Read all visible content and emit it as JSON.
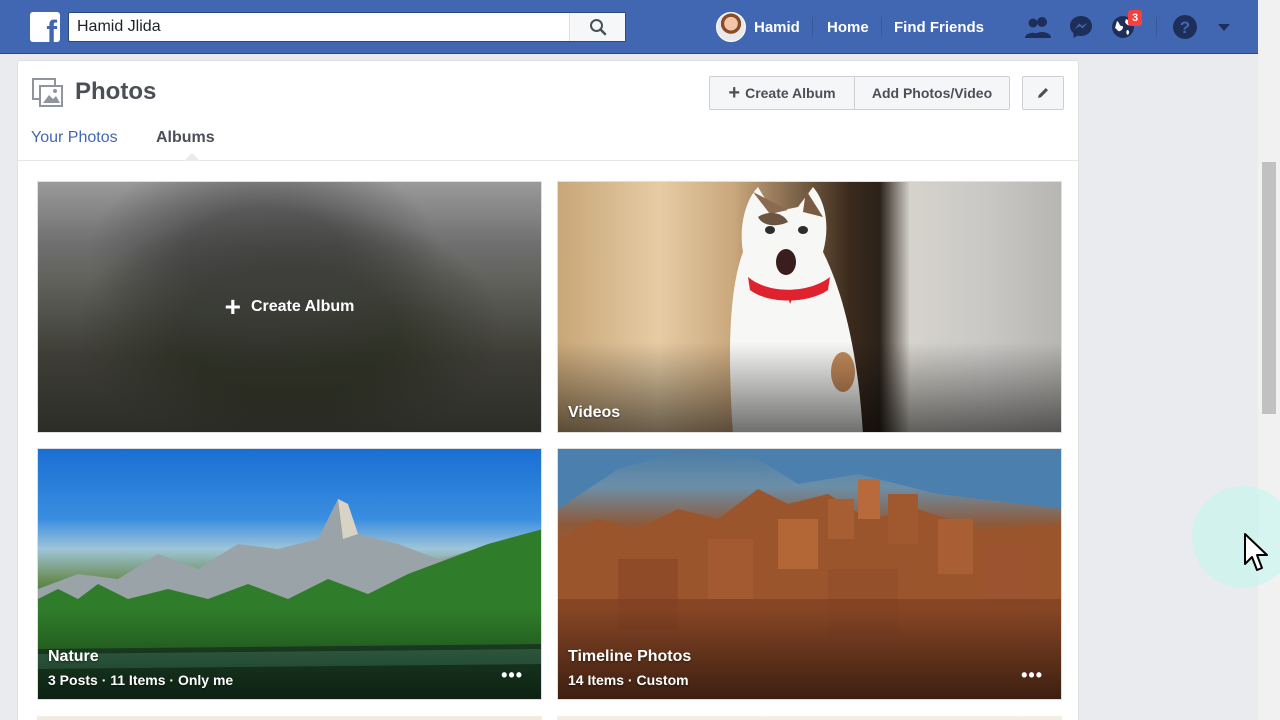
{
  "topbar": {
    "search_value": "Hamid Jlida",
    "user_name": "Hamid",
    "home_label": "Home",
    "find_friends_label": "Find Friends",
    "notification_count": "3"
  },
  "photos": {
    "title": "Photos",
    "create_album_button": "Create Album",
    "add_media_button": "Add Photos/Video",
    "tabs": [
      {
        "label": "Your Photos"
      },
      {
        "label": "Albums"
      }
    ]
  },
  "albums": [
    {
      "title": "Create Album"
    },
    {
      "title": "Videos"
    },
    {
      "title": "Nature",
      "meta": "3 Posts · 11 Items · Only me"
    },
    {
      "title": "Timeline Photos",
      "meta": "14 Items · Custom"
    }
  ],
  "colors": {
    "brand": "#4267b2",
    "badge": "#fa3e3e",
    "page_bg": "#e9ebee"
  }
}
